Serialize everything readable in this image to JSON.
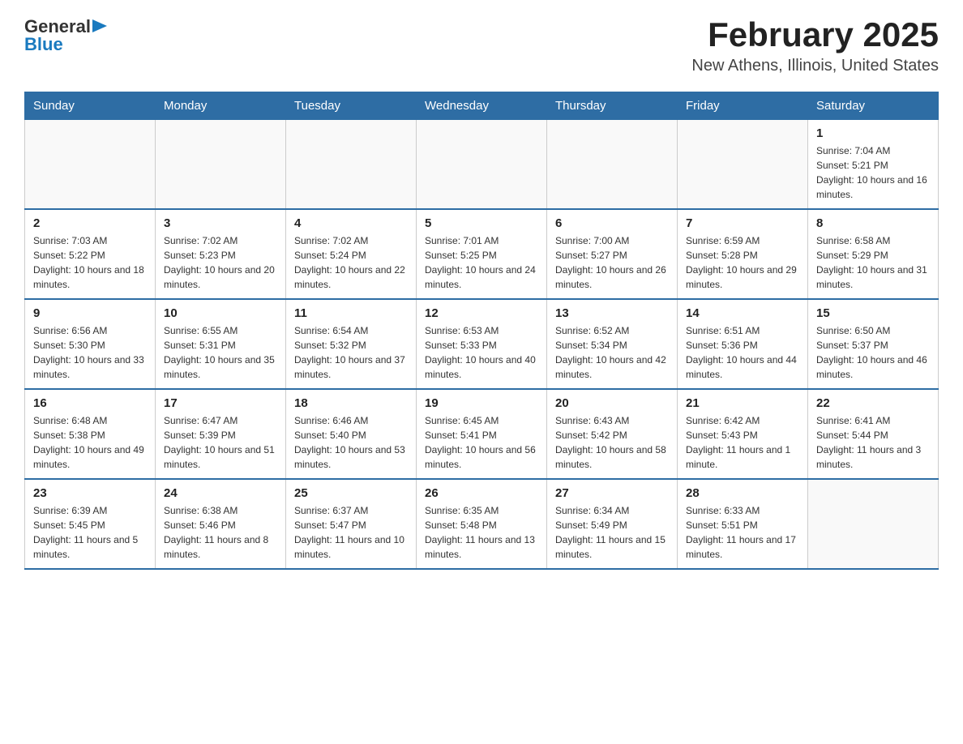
{
  "logo": {
    "text_general": "General",
    "text_blue": "Blue",
    "arrow": "▶"
  },
  "title": "February 2025",
  "subtitle": "New Athens, Illinois, United States",
  "days_of_week": [
    "Sunday",
    "Monday",
    "Tuesday",
    "Wednesday",
    "Thursday",
    "Friday",
    "Saturday"
  ],
  "weeks": [
    [
      {
        "day": "",
        "info": ""
      },
      {
        "day": "",
        "info": ""
      },
      {
        "day": "",
        "info": ""
      },
      {
        "day": "",
        "info": ""
      },
      {
        "day": "",
        "info": ""
      },
      {
        "day": "",
        "info": ""
      },
      {
        "day": "1",
        "info": "Sunrise: 7:04 AM\nSunset: 5:21 PM\nDaylight: 10 hours and 16 minutes."
      }
    ],
    [
      {
        "day": "2",
        "info": "Sunrise: 7:03 AM\nSunset: 5:22 PM\nDaylight: 10 hours and 18 minutes."
      },
      {
        "day": "3",
        "info": "Sunrise: 7:02 AM\nSunset: 5:23 PM\nDaylight: 10 hours and 20 minutes."
      },
      {
        "day": "4",
        "info": "Sunrise: 7:02 AM\nSunset: 5:24 PM\nDaylight: 10 hours and 22 minutes."
      },
      {
        "day": "5",
        "info": "Sunrise: 7:01 AM\nSunset: 5:25 PM\nDaylight: 10 hours and 24 minutes."
      },
      {
        "day": "6",
        "info": "Sunrise: 7:00 AM\nSunset: 5:27 PM\nDaylight: 10 hours and 26 minutes."
      },
      {
        "day": "7",
        "info": "Sunrise: 6:59 AM\nSunset: 5:28 PM\nDaylight: 10 hours and 29 minutes."
      },
      {
        "day": "8",
        "info": "Sunrise: 6:58 AM\nSunset: 5:29 PM\nDaylight: 10 hours and 31 minutes."
      }
    ],
    [
      {
        "day": "9",
        "info": "Sunrise: 6:56 AM\nSunset: 5:30 PM\nDaylight: 10 hours and 33 minutes."
      },
      {
        "day": "10",
        "info": "Sunrise: 6:55 AM\nSunset: 5:31 PM\nDaylight: 10 hours and 35 minutes."
      },
      {
        "day": "11",
        "info": "Sunrise: 6:54 AM\nSunset: 5:32 PM\nDaylight: 10 hours and 37 minutes."
      },
      {
        "day": "12",
        "info": "Sunrise: 6:53 AM\nSunset: 5:33 PM\nDaylight: 10 hours and 40 minutes."
      },
      {
        "day": "13",
        "info": "Sunrise: 6:52 AM\nSunset: 5:34 PM\nDaylight: 10 hours and 42 minutes."
      },
      {
        "day": "14",
        "info": "Sunrise: 6:51 AM\nSunset: 5:36 PM\nDaylight: 10 hours and 44 minutes."
      },
      {
        "day": "15",
        "info": "Sunrise: 6:50 AM\nSunset: 5:37 PM\nDaylight: 10 hours and 46 minutes."
      }
    ],
    [
      {
        "day": "16",
        "info": "Sunrise: 6:48 AM\nSunset: 5:38 PM\nDaylight: 10 hours and 49 minutes."
      },
      {
        "day": "17",
        "info": "Sunrise: 6:47 AM\nSunset: 5:39 PM\nDaylight: 10 hours and 51 minutes."
      },
      {
        "day": "18",
        "info": "Sunrise: 6:46 AM\nSunset: 5:40 PM\nDaylight: 10 hours and 53 minutes."
      },
      {
        "day": "19",
        "info": "Sunrise: 6:45 AM\nSunset: 5:41 PM\nDaylight: 10 hours and 56 minutes."
      },
      {
        "day": "20",
        "info": "Sunrise: 6:43 AM\nSunset: 5:42 PM\nDaylight: 10 hours and 58 minutes."
      },
      {
        "day": "21",
        "info": "Sunrise: 6:42 AM\nSunset: 5:43 PM\nDaylight: 11 hours and 1 minute."
      },
      {
        "day": "22",
        "info": "Sunrise: 6:41 AM\nSunset: 5:44 PM\nDaylight: 11 hours and 3 minutes."
      }
    ],
    [
      {
        "day": "23",
        "info": "Sunrise: 6:39 AM\nSunset: 5:45 PM\nDaylight: 11 hours and 5 minutes."
      },
      {
        "day": "24",
        "info": "Sunrise: 6:38 AM\nSunset: 5:46 PM\nDaylight: 11 hours and 8 minutes."
      },
      {
        "day": "25",
        "info": "Sunrise: 6:37 AM\nSunset: 5:47 PM\nDaylight: 11 hours and 10 minutes."
      },
      {
        "day": "26",
        "info": "Sunrise: 6:35 AM\nSunset: 5:48 PM\nDaylight: 11 hours and 13 minutes."
      },
      {
        "day": "27",
        "info": "Sunrise: 6:34 AM\nSunset: 5:49 PM\nDaylight: 11 hours and 15 minutes."
      },
      {
        "day": "28",
        "info": "Sunrise: 6:33 AM\nSunset: 5:51 PM\nDaylight: 11 hours and 17 minutes."
      },
      {
        "day": "",
        "info": ""
      }
    ]
  ]
}
